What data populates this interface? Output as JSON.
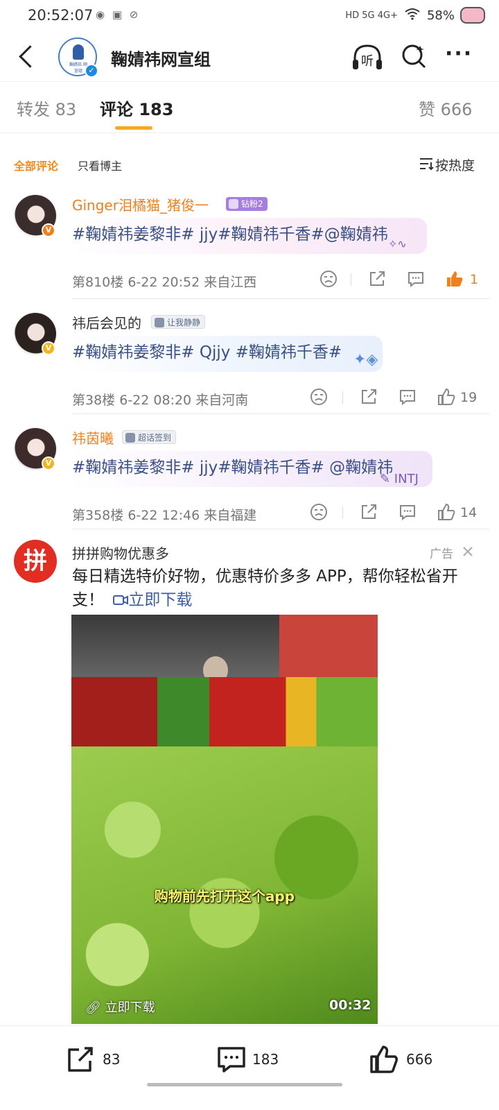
{
  "status_bar": {
    "time": "20:52:07",
    "left_icons": [
      "weibo-icon",
      "app-icon",
      "link-icon"
    ],
    "network": "HD 5G 4G+",
    "battery": "58%"
  },
  "header": {
    "title": "鞠婧祎网宣组",
    "avatar_text": "鞠婧祎 网宣组",
    "verified": true
  },
  "tabs": [
    {
      "label": "转发 83"
    },
    {
      "label": "评论 183",
      "active": true
    },
    {
      "label": "赞 666"
    }
  ],
  "filters": {
    "all": "全部评论",
    "poster_only": "只看博主",
    "sort": "按热度"
  },
  "comments": [
    {
      "user": "Ginger泪橘猫_猪俊一",
      "badge": "钻粉2",
      "text": "#鞠婧祎姜黎非# jjy#鞠婧祎千香#@鞠婧祎",
      "floor": "第810楼",
      "date": "6-22 20:52",
      "location": "来自江西",
      "likes": "1"
    },
    {
      "user": "祎后会见的",
      "badge": "让我静静",
      "text": "#鞠婧祎姜黎非# Qjjy #鞠婧祎千香#",
      "floor": "第38楼",
      "date": "6-22 08:20",
      "location": "来自河南",
      "likes": "19"
    },
    {
      "user": "祎茵曦",
      "badge": "超话签到",
      "text": "#鞠婧祎姜黎非# jjy#鞠婧祎千香# @鞠婧祎",
      "floor": "第358楼",
      "date": "6-22 12:46",
      "location": "来自福建",
      "likes": "14"
    }
  ],
  "ad": {
    "logo_text": "拼",
    "name": "拼拼购物优惠多",
    "tag": "广告",
    "text": "每日精选特价好物，优惠特价多多 APP，帮你轻松省开支！",
    "download": "立即下载",
    "video_caption": "购物前先打开这个app",
    "video_link": "立即下载",
    "duration": "00:32"
  },
  "bottom_bar": {
    "reposts": "83",
    "comments": "183",
    "likes": "666"
  },
  "colors": {
    "accent": "#f28a1c",
    "link": "#3a5087",
    "tab_underline": "#f7a922"
  }
}
